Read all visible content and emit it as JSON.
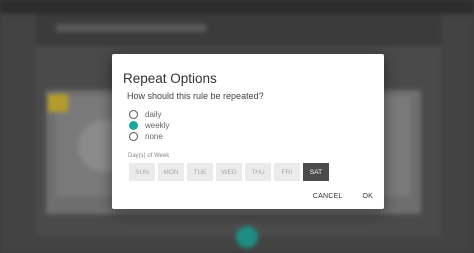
{
  "dialog": {
    "title": "Repeat Options",
    "question": "How should this rule be repeated?",
    "options": [
      {
        "label": "daily",
        "selected": false
      },
      {
        "label": "weekly",
        "selected": true
      },
      {
        "label": "none",
        "selected": false
      }
    ],
    "days_label": "Day(s) of Week",
    "days": [
      {
        "label": "SUN",
        "selected": false
      },
      {
        "label": "MON",
        "selected": false
      },
      {
        "label": "TUE",
        "selected": false
      },
      {
        "label": "WED",
        "selected": false
      },
      {
        "label": "THU",
        "selected": false
      },
      {
        "label": "FRI",
        "selected": false
      },
      {
        "label": "SAT",
        "selected": true
      }
    ],
    "cancel_label": "CANCEL",
    "ok_label": "OK"
  },
  "colors": {
    "accent": "#1aa89c",
    "selected_day": "#4b4b4b",
    "overlay": "#3a3a3a"
  }
}
